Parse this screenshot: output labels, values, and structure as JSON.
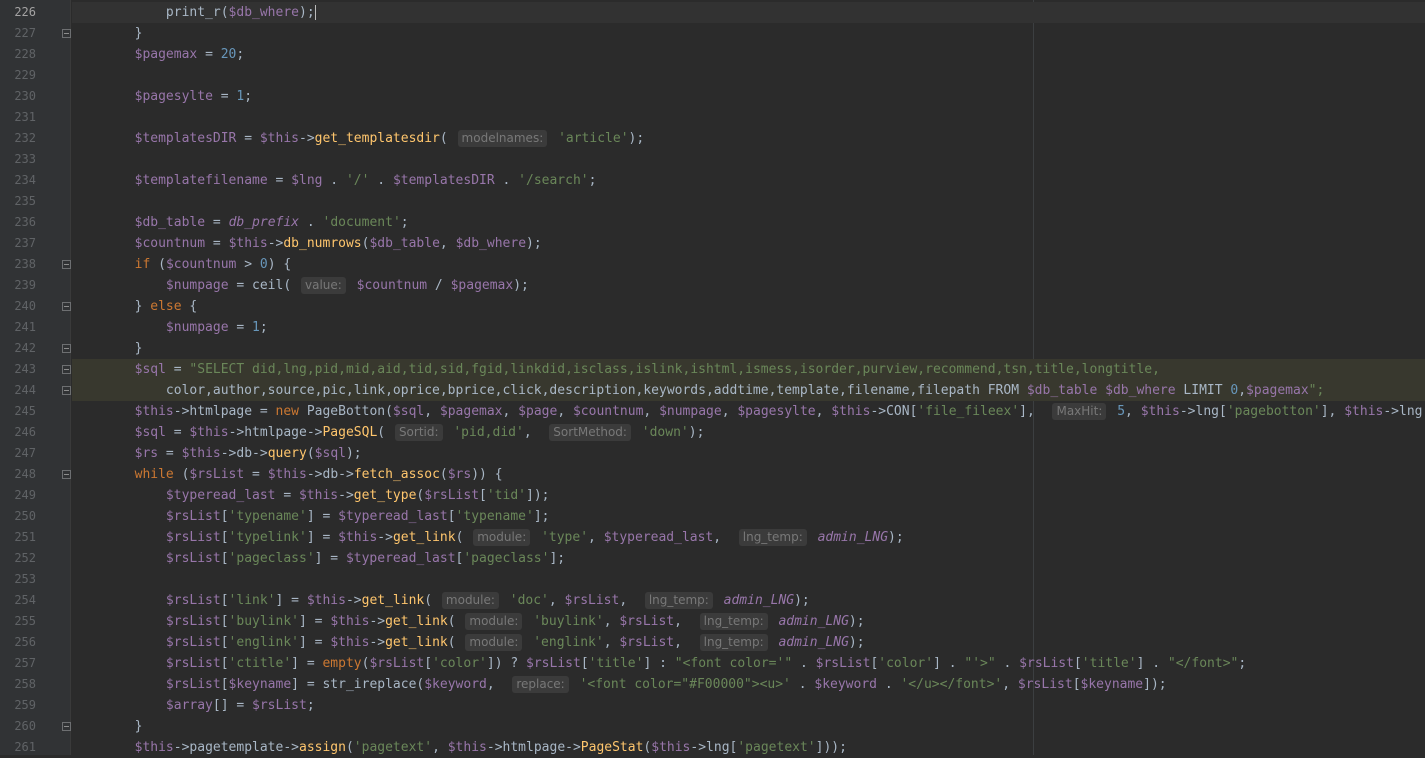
{
  "editor": {
    "current_line": "226",
    "lines": [
      {
        "num": "226",
        "text": "            print_r($db_where);",
        "fold": false
      },
      {
        "num": "227",
        "text": "        }",
        "fold": true
      },
      {
        "num": "228",
        "text": "        $pagemax = 20;",
        "fold": false
      },
      {
        "num": "229",
        "text": "",
        "fold": false
      },
      {
        "num": "230",
        "text": "        $pagesylte = 1;",
        "fold": false
      },
      {
        "num": "231",
        "text": "",
        "fold": false
      },
      {
        "num": "232",
        "text": "        $templatesDIR = $this->get_templatesdir( modelnames: 'article');",
        "fold": false
      },
      {
        "num": "233",
        "text": "",
        "fold": false
      },
      {
        "num": "234",
        "text": "        $templatefilename = $lng . '/' . $templatesDIR . '/search';",
        "fold": false
      },
      {
        "num": "235",
        "text": "",
        "fold": false
      },
      {
        "num": "236",
        "text": "        $db_table = db_prefix . 'document';",
        "fold": false
      },
      {
        "num": "237",
        "text": "        $countnum = $this->db_numrows($db_table, $db_where);",
        "fold": false
      },
      {
        "num": "238",
        "text": "        if ($countnum > 0) {",
        "fold": true
      },
      {
        "num": "239",
        "text": "            $numpage = ceil( value: $countnum / $pagemax);",
        "fold": false
      },
      {
        "num": "240",
        "text": "        } else {",
        "fold": true
      },
      {
        "num": "241",
        "text": "            $numpage = 1;",
        "fold": false
      },
      {
        "num": "242",
        "text": "        }",
        "fold": true
      },
      {
        "num": "243",
        "text": "        $sql = \"SELECT did,lng,pid,mid,aid,tid,sid,fgid,linkdid,isclass,islink,ishtml,ismess,isorder,purview,recommend,tsn,title,longtitle,",
        "fold": true
      },
      {
        "num": "244",
        "text": "            color,author,source,pic,link,oprice,bprice,click,description,keywords,addtime,template,filename,filepath FROM $db_table $db_where LIMIT 0,$pagemax\";",
        "fold": true
      },
      {
        "num": "245",
        "text": "        $this->htmlpage = new PageBotton($sql, $pagemax, $page, $countnum, $numpage, $pagesylte, $this->CON['file_fileex'],  MaxHit: 5, $this->lng['pagebotton'], $this->lng",
        "fold": false
      },
      {
        "num": "246",
        "text": "        $sql = $this->htmlpage->PageSQL( Sortid: 'pid,did',  SortMethod: 'down');",
        "fold": false
      },
      {
        "num": "247",
        "text": "        $rs = $this->db->query($sql);",
        "fold": false
      },
      {
        "num": "248",
        "text": "        while ($rsList = $this->db->fetch_assoc($rs)) {",
        "fold": true
      },
      {
        "num": "249",
        "text": "            $typeread_last = $this->get_type($rsList['tid']);",
        "fold": false
      },
      {
        "num": "250",
        "text": "            $rsList['typename'] = $typeread_last['typename'];",
        "fold": false
      },
      {
        "num": "251",
        "text": "            $rsList['typelink'] = $this->get_link( module: 'type', $typeread_last,  lng_temp: admin_LNG);",
        "fold": false
      },
      {
        "num": "252",
        "text": "            $rsList['pageclass'] = $typeread_last['pageclass'];",
        "fold": false
      },
      {
        "num": "253",
        "text": "",
        "fold": false
      },
      {
        "num": "254",
        "text": "            $rsList['link'] = $this->get_link( module: 'doc', $rsList,  lng_temp: admin_LNG);",
        "fold": false
      },
      {
        "num": "255",
        "text": "            $rsList['buylink'] = $this->get_link( module: 'buylink', $rsList,  lng_temp: admin_LNG);",
        "fold": false
      },
      {
        "num": "256",
        "text": "            $rsList['englink'] = $this->get_link( module: 'englink', $rsList,  lng_temp: admin_LNG);",
        "fold": false
      },
      {
        "num": "257",
        "text": "            $rsList['ctitle'] = empty($rsList['color']) ? $rsList['title'] : \"<font color='\" . $rsList['color'] . \"'>\" . $rsList['title'] . \"</font>\";",
        "fold": false
      },
      {
        "num": "258",
        "text": "            $rsList[$keyname] = str_ireplace($keyword,  replace: '<font color=\"#F00000\"><u>' . $keyword . '</u></font>', $rsList[$keyname]);",
        "fold": false
      },
      {
        "num": "259",
        "text": "            $array[] = $rsList;",
        "fold": false
      },
      {
        "num": "260",
        "text": "        }",
        "fold": true
      },
      {
        "num": "261",
        "text": "        $this->pagetemplate->assign('pagetext', $this->htmlpage->PageStat($this->lng['pagetext']));",
        "fold": false
      }
    ]
  },
  "colors": {
    "background": "#2b2b2b",
    "gutter": "#313335",
    "keyword": "#cc7832",
    "variable": "#9876aa",
    "function": "#ffc66d",
    "string": "#6a8759",
    "number": "#6897bb"
  }
}
